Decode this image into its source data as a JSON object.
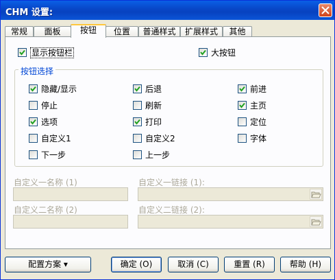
{
  "window": {
    "title": "CHM 设置:"
  },
  "tabs": [
    {
      "label": "常规"
    },
    {
      "label": "面板"
    },
    {
      "label": "按钮"
    },
    {
      "label": "位置"
    },
    {
      "label": "普通样式"
    },
    {
      "label": "扩展样式"
    },
    {
      "label": "其他"
    }
  ],
  "active_tab": "按钮",
  "top_options": {
    "show_toolbar": {
      "label": "显示按钮栏",
      "checked": true
    },
    "large_buttons": {
      "label": "大按钮",
      "checked": true
    }
  },
  "button_group": {
    "title": "按钮选择",
    "items": [
      {
        "label": "隐藏/显示",
        "checked": true
      },
      {
        "label": "后退",
        "checked": true
      },
      {
        "label": "前进",
        "checked": true
      },
      {
        "label": "停止",
        "checked": false
      },
      {
        "label": "刷新",
        "checked": false
      },
      {
        "label": "主页",
        "checked": true
      },
      {
        "label": "选项",
        "checked": true
      },
      {
        "label": "打印",
        "checked": true
      },
      {
        "label": "定位",
        "checked": false
      },
      {
        "label": "自定义1",
        "checked": false
      },
      {
        "label": "自定义2",
        "checked": false
      },
      {
        "label": "字体",
        "checked": false
      },
      {
        "label": "下一步",
        "checked": false
      },
      {
        "label": "上一步",
        "checked": false
      }
    ]
  },
  "custom_fields": {
    "name1_label": "自定义一名称 (1)",
    "link1_label": "自定义一链接 (1):",
    "name2_label": "自定义二名称 (2)",
    "link2_label": "自定义二链接 (2):",
    "name1_value": "",
    "link1_value": "",
    "name2_value": "",
    "link2_value": ""
  },
  "footer": {
    "config_label": "配置方案 ▾",
    "ok_label": "确定 (O)",
    "cancel_label": "取消 (C)",
    "reset_label": "重置 (R)",
    "help_label": "帮助 (H)"
  },
  "colors": {
    "titlebar": "#0A5FE6",
    "dialog_bg": "#ECE9D8",
    "group_title": "#0046D5",
    "check": "#21A121"
  }
}
